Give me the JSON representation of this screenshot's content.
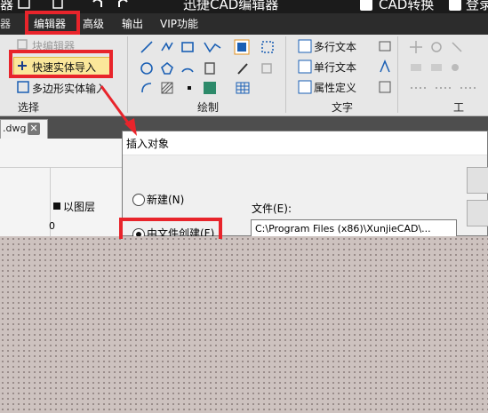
{
  "app": {
    "title": "迅捷CAD编辑器",
    "convert_label": "CAD转换",
    "login_label": "登录",
    "left_cut_label": "器"
  },
  "menu": {
    "items": [
      "编辑器",
      "高级",
      "输出",
      "VIP功能"
    ]
  },
  "ribbon": {
    "select_group": {
      "label": "选择",
      "block_editor": "块编辑器",
      "quick_import": "快速实体导入",
      "polygon_input": "多边形实体输入"
    },
    "draw_group": {
      "label": "绘制"
    },
    "text_group": {
      "label": "文字",
      "multiline": "多行文本",
      "singleline": "单行文本",
      "attribute": "属性定义"
    },
    "tools_group": {
      "label": "工"
    }
  },
  "tabs": {
    "file": ".dwg",
    "close_glyph": "✕"
  },
  "left_panel": {
    "layer_label": "以图层",
    "value": "0"
  },
  "dialog": {
    "title": "插入对象",
    "option_new": "新建(N)",
    "option_from_file": "由文件创建(F)",
    "file_label": "文件(E):",
    "file_path": "C:\\Program Files (x86)\\XunjieCAD\\..."
  },
  "colors": {
    "highlight": "#e8242b",
    "menubar": "#2c2c2c",
    "ribbon": "#e7e7e7"
  }
}
